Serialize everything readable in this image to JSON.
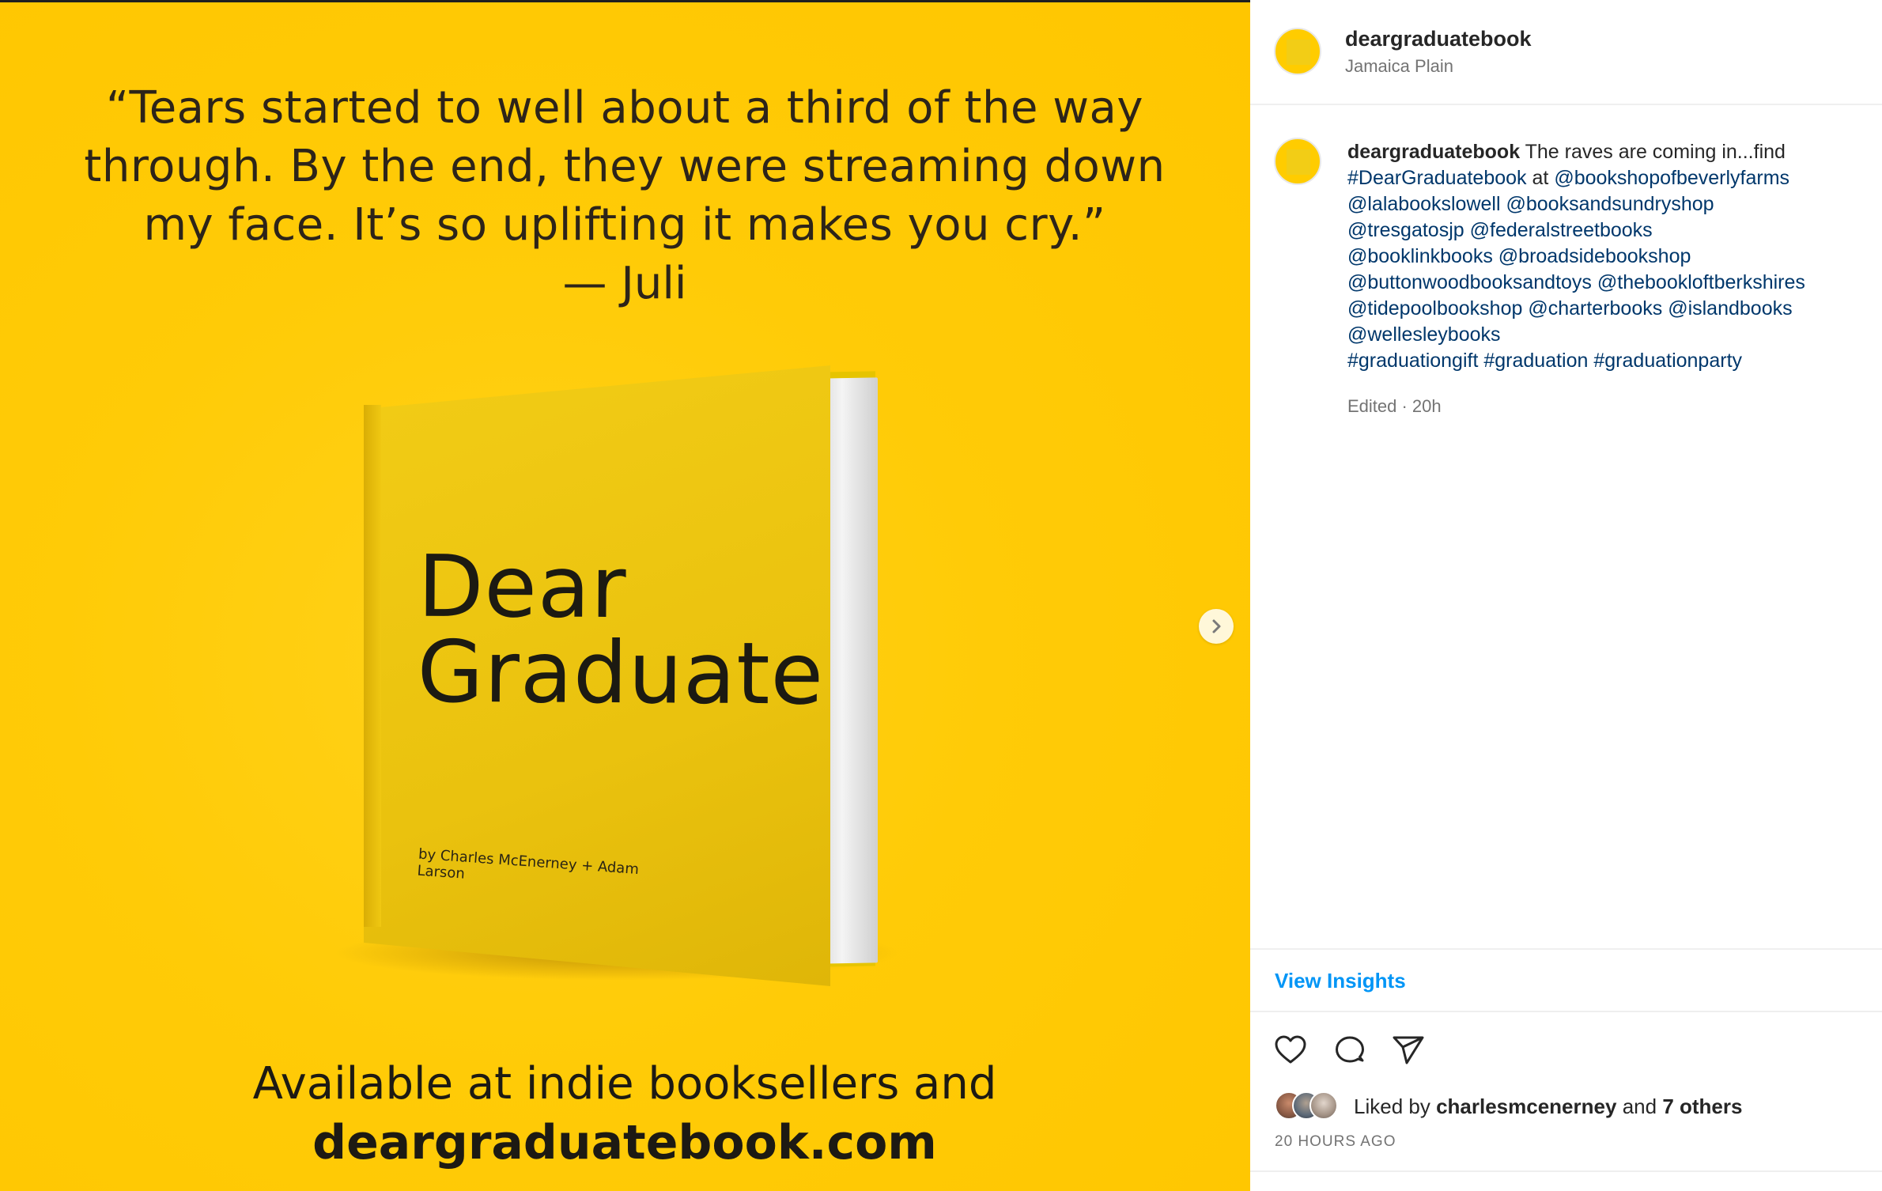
{
  "post_image": {
    "quote": "“Tears started to well about a third of the way through. By the end, they were streaming down my face. It’s so uplifting it makes you cry.”",
    "quote_author": "— Juli",
    "book_title_line1": "Dear",
    "book_title_line2": "Graduate",
    "book_authors": "by Charles McEnerney + Adam Larson",
    "available_text": "Available at indie booksellers and",
    "website": "deargraduatebook.com",
    "background_color": "#ffc600",
    "next_icon": "chevron-right-icon"
  },
  "header": {
    "username": "deargraduatebook",
    "location": "Jamaica Plain"
  },
  "caption": {
    "username": "deargraduatebook",
    "text": "The raves are coming in...find",
    "hashtag_book": "#DearGraduatebook",
    "at_word": "at",
    "mentions": [
      "@bookshopofbeverlyfarms",
      "@lalabookslowell",
      "@booksandsundryshop",
      "@tresgatosjp",
      "@federalstreetbooks",
      "@booklinkbooks",
      "@broadsidebookshop",
      "@buttonwoodbooksandtoys",
      "@thebookloftberkshires",
      "@tidepoolbookshop",
      "@charterbooks",
      "@islandbooks",
      "@wellesleybooks"
    ],
    "hashtags": [
      "#graduationgift",
      "#graduation",
      "#graduationparty"
    ],
    "edited": "Edited · 20h"
  },
  "actions": {
    "view_insights": "View Insights",
    "like_icon": "heart-icon",
    "comment_icon": "comment-icon",
    "share_icon": "send-icon"
  },
  "likes": {
    "prefix": "Liked by",
    "user": "charlesmcenerney",
    "and": "and",
    "others": "7 others"
  },
  "timestamp": "20 HOURS AGO",
  "colors": {
    "link": "#00376b",
    "accent": "#0095f6",
    "muted": "#737373"
  }
}
